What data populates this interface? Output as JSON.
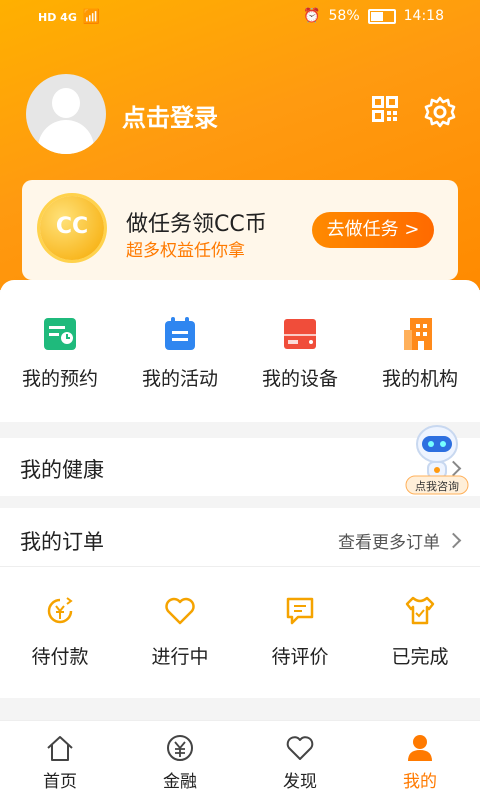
{
  "status": {
    "left": "HD 4G",
    "battery": "58%",
    "time": "14:18"
  },
  "profile": {
    "login_label": "点击登录"
  },
  "task_card": {
    "coin_text": "CC",
    "title": "做任务领CC币",
    "subtitle": "超多权益任你拿",
    "button": "去做任务 >"
  },
  "quick_actions": [
    {
      "label": "我的预约",
      "icon": "calendar-check-icon"
    },
    {
      "label": "我的活动",
      "icon": "activity-notebook-icon"
    },
    {
      "label": "我的设备",
      "icon": "device-icon"
    },
    {
      "label": "我的机构",
      "icon": "building-icon"
    }
  ],
  "health": {
    "title": "我的健康",
    "robot_label": "点我咨询"
  },
  "orders": {
    "title": "我的订单",
    "more": "查看更多订单",
    "items": [
      {
        "label": "待付款",
        "icon": "yen-clock-icon"
      },
      {
        "label": "进行中",
        "icon": "heart-outline-icon"
      },
      {
        "label": "待评价",
        "icon": "comment-icon"
      },
      {
        "label": "已完成",
        "icon": "shirt-check-icon"
      }
    ]
  },
  "tabs": [
    {
      "label": "首页",
      "icon": "home-icon"
    },
    {
      "label": "金融",
      "icon": "yen-circle-icon"
    },
    {
      "label": "发现",
      "icon": "heart-icon"
    },
    {
      "label": "我的",
      "icon": "person-icon",
      "active": true
    }
  ],
  "colors": {
    "accent": "#ff7a00",
    "hero": "#ffa000"
  }
}
